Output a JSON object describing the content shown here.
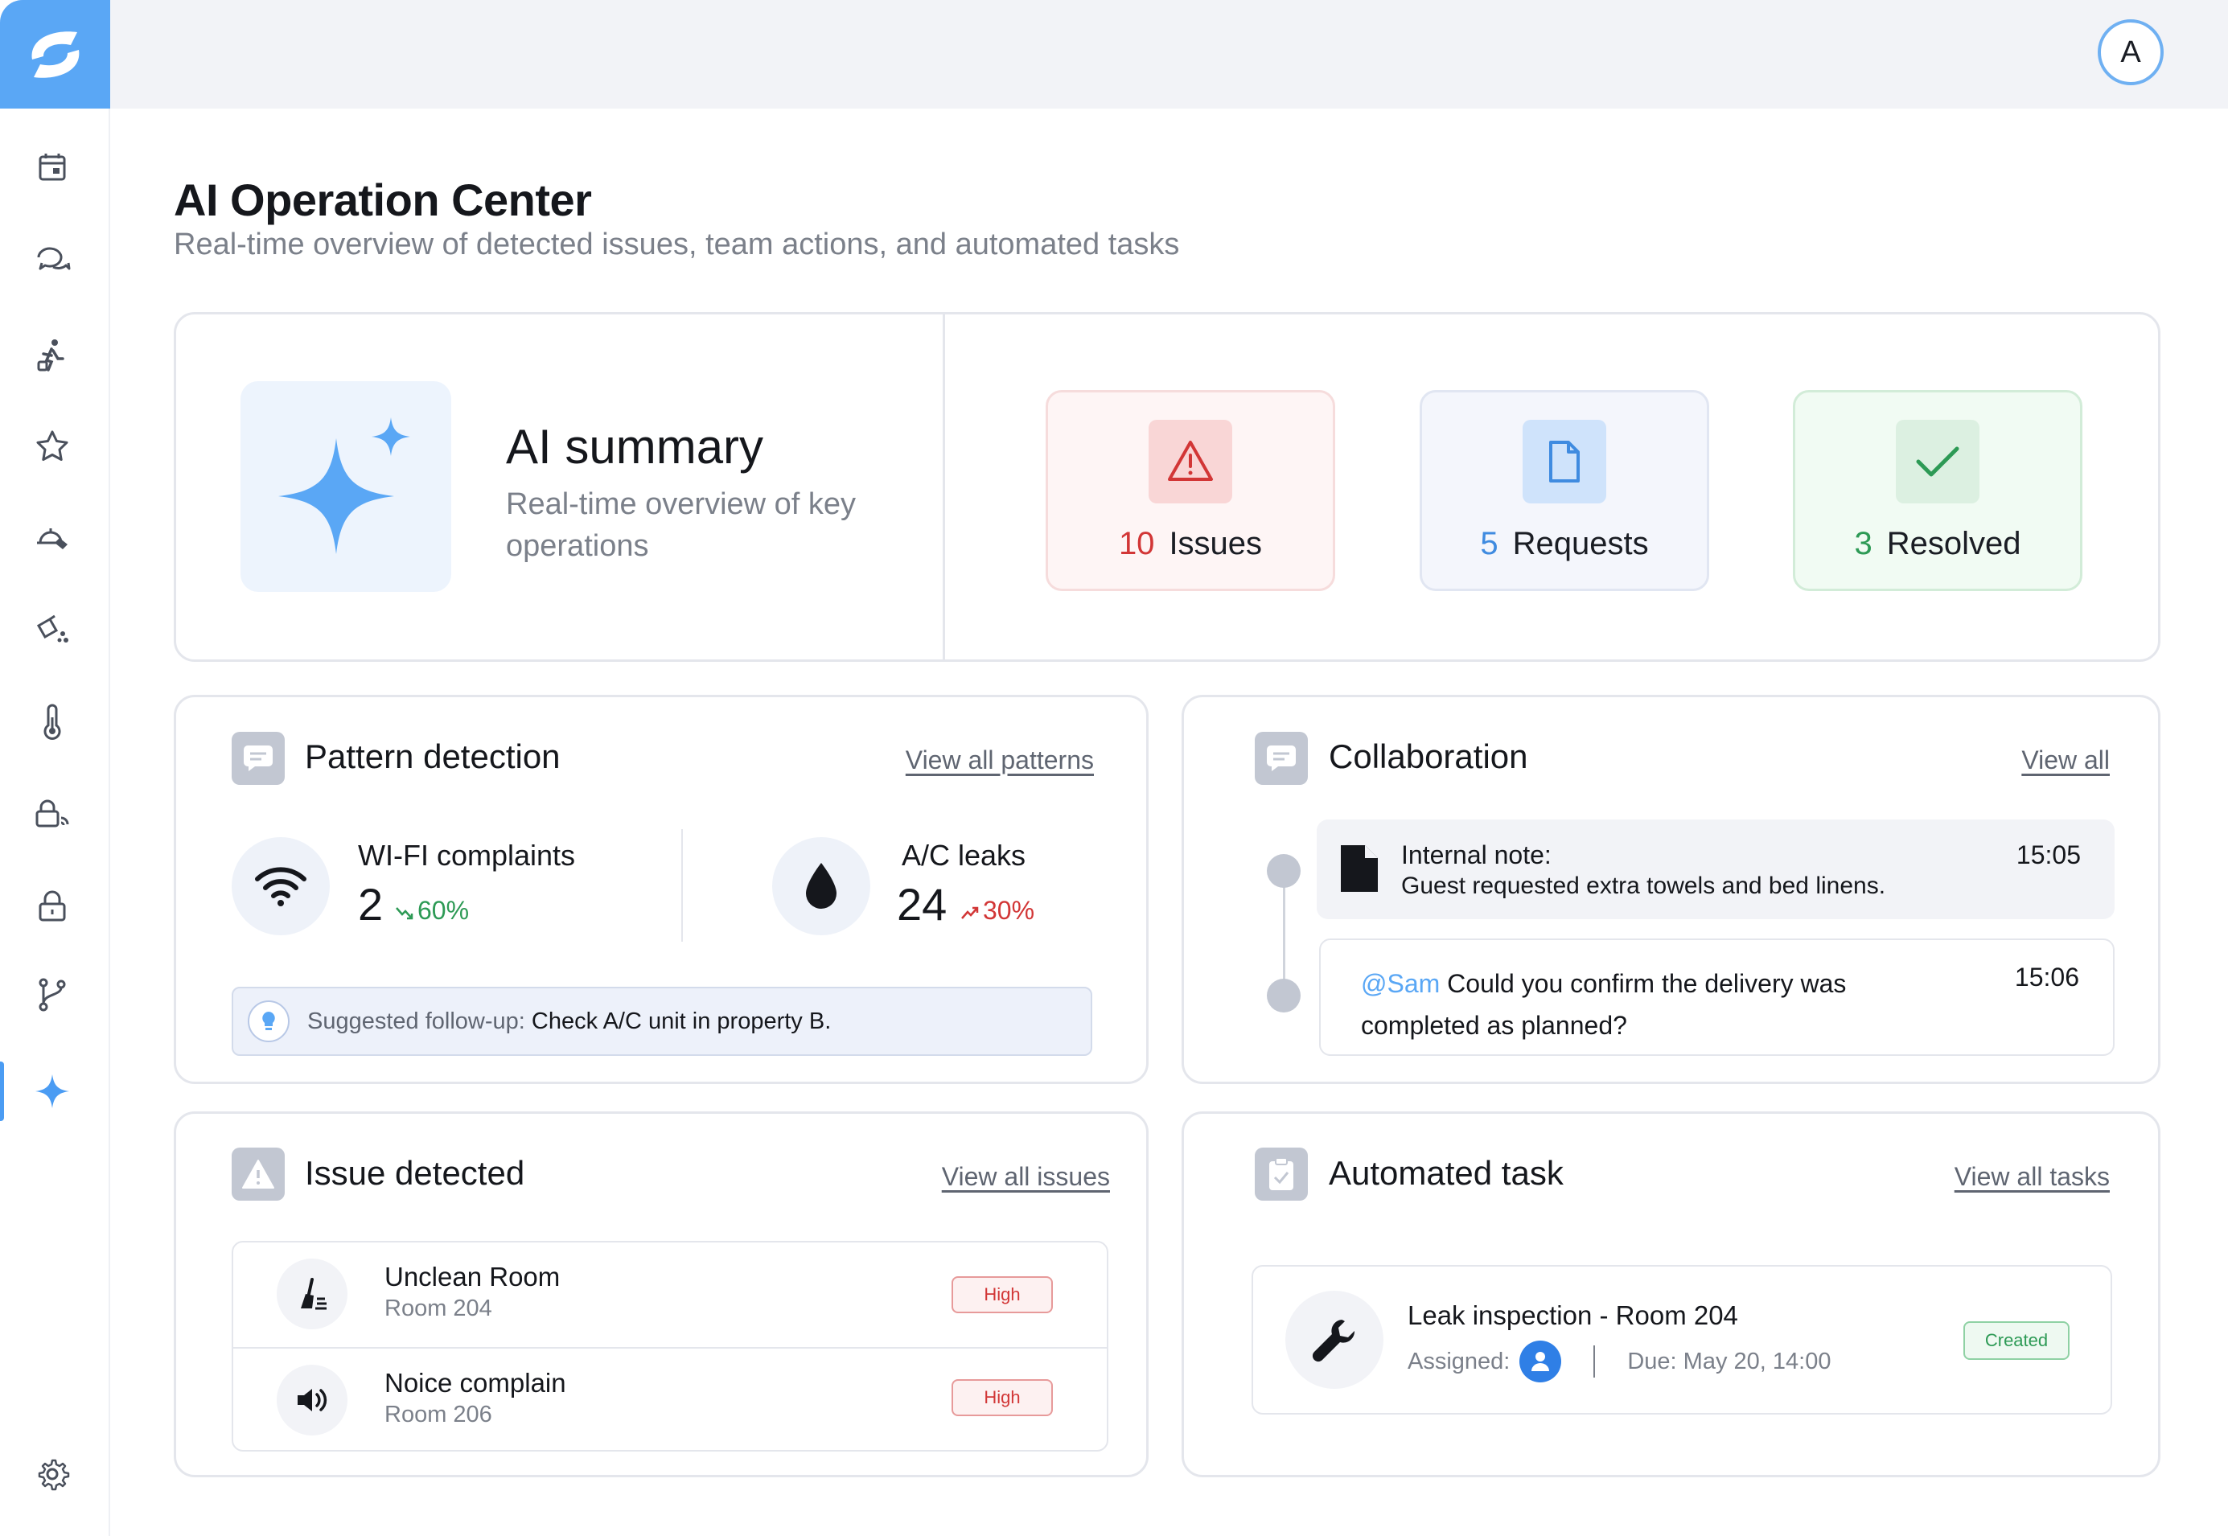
{
  "app": {
    "avatar_initial": "A"
  },
  "sidebar": {
    "items": [
      {
        "icon": "calendar-icon"
      },
      {
        "icon": "chat-icon"
      },
      {
        "icon": "guest-icon"
      },
      {
        "icon": "star-icon"
      },
      {
        "icon": "room-service-icon"
      },
      {
        "icon": "cleaning-icon"
      },
      {
        "icon": "thermometer-icon"
      },
      {
        "icon": "wifi-lock-icon"
      },
      {
        "icon": "lock-icon"
      },
      {
        "icon": "branch-icon"
      },
      {
        "icon": "sparkle-icon",
        "active": true
      }
    ],
    "settings_icon": "gear-icon"
  },
  "header": {
    "title": "AI Operation Center",
    "subtitle": "Real-time overview of detected issues, team actions, and automated tasks"
  },
  "summary": {
    "title": "AI summary",
    "subtitle": "Real-time overview of key operations",
    "stats": {
      "issues": {
        "count": "10",
        "label": "Issues",
        "color": "#d23636"
      },
      "requests": {
        "count": "5",
        "label": "Requests",
        "color": "#3f8be0"
      },
      "resolved": {
        "count": "3",
        "label": "Resolved",
        "color": "#2d9a55"
      }
    }
  },
  "pattern": {
    "title": "Pattern detection",
    "link": "View all patterns",
    "metrics": [
      {
        "label": "WI-FI  complaints",
        "value": "2",
        "change": "60%",
        "direction": "down",
        "color": "#2d9a55"
      },
      {
        "label": "A/C  leaks",
        "value": "24",
        "change": "30%",
        "direction": "up",
        "color": "#d23636"
      }
    ],
    "followup_prefix": "Suggested follow-up: ",
    "followup_text": "Check A/C unit in property B."
  },
  "collaboration": {
    "title": "Collaboration",
    "link": "View all",
    "notes": [
      {
        "heading": "Internal note:",
        "body": "Guest requested extra towels and bed linens.",
        "time": "15:05"
      },
      {
        "mention": "@Sam",
        "body": " Could you confirm the delivery was completed as planned?",
        "time": "15:06"
      }
    ]
  },
  "issues": {
    "title": "Issue detected",
    "link": "View all issues",
    "rows": [
      {
        "title": "Unclean Room",
        "room": "Room 204",
        "priority": "High"
      },
      {
        "title": "Noice complain",
        "room": "Room 206",
        "priority": "High"
      }
    ]
  },
  "tasks": {
    "title": "Automated task",
    "link": "View all tasks",
    "item": {
      "title": "Leak inspection - Room 204",
      "assigned_label": "Assigned:",
      "due": "Due: May 20, 14:00",
      "status": "Created"
    }
  }
}
